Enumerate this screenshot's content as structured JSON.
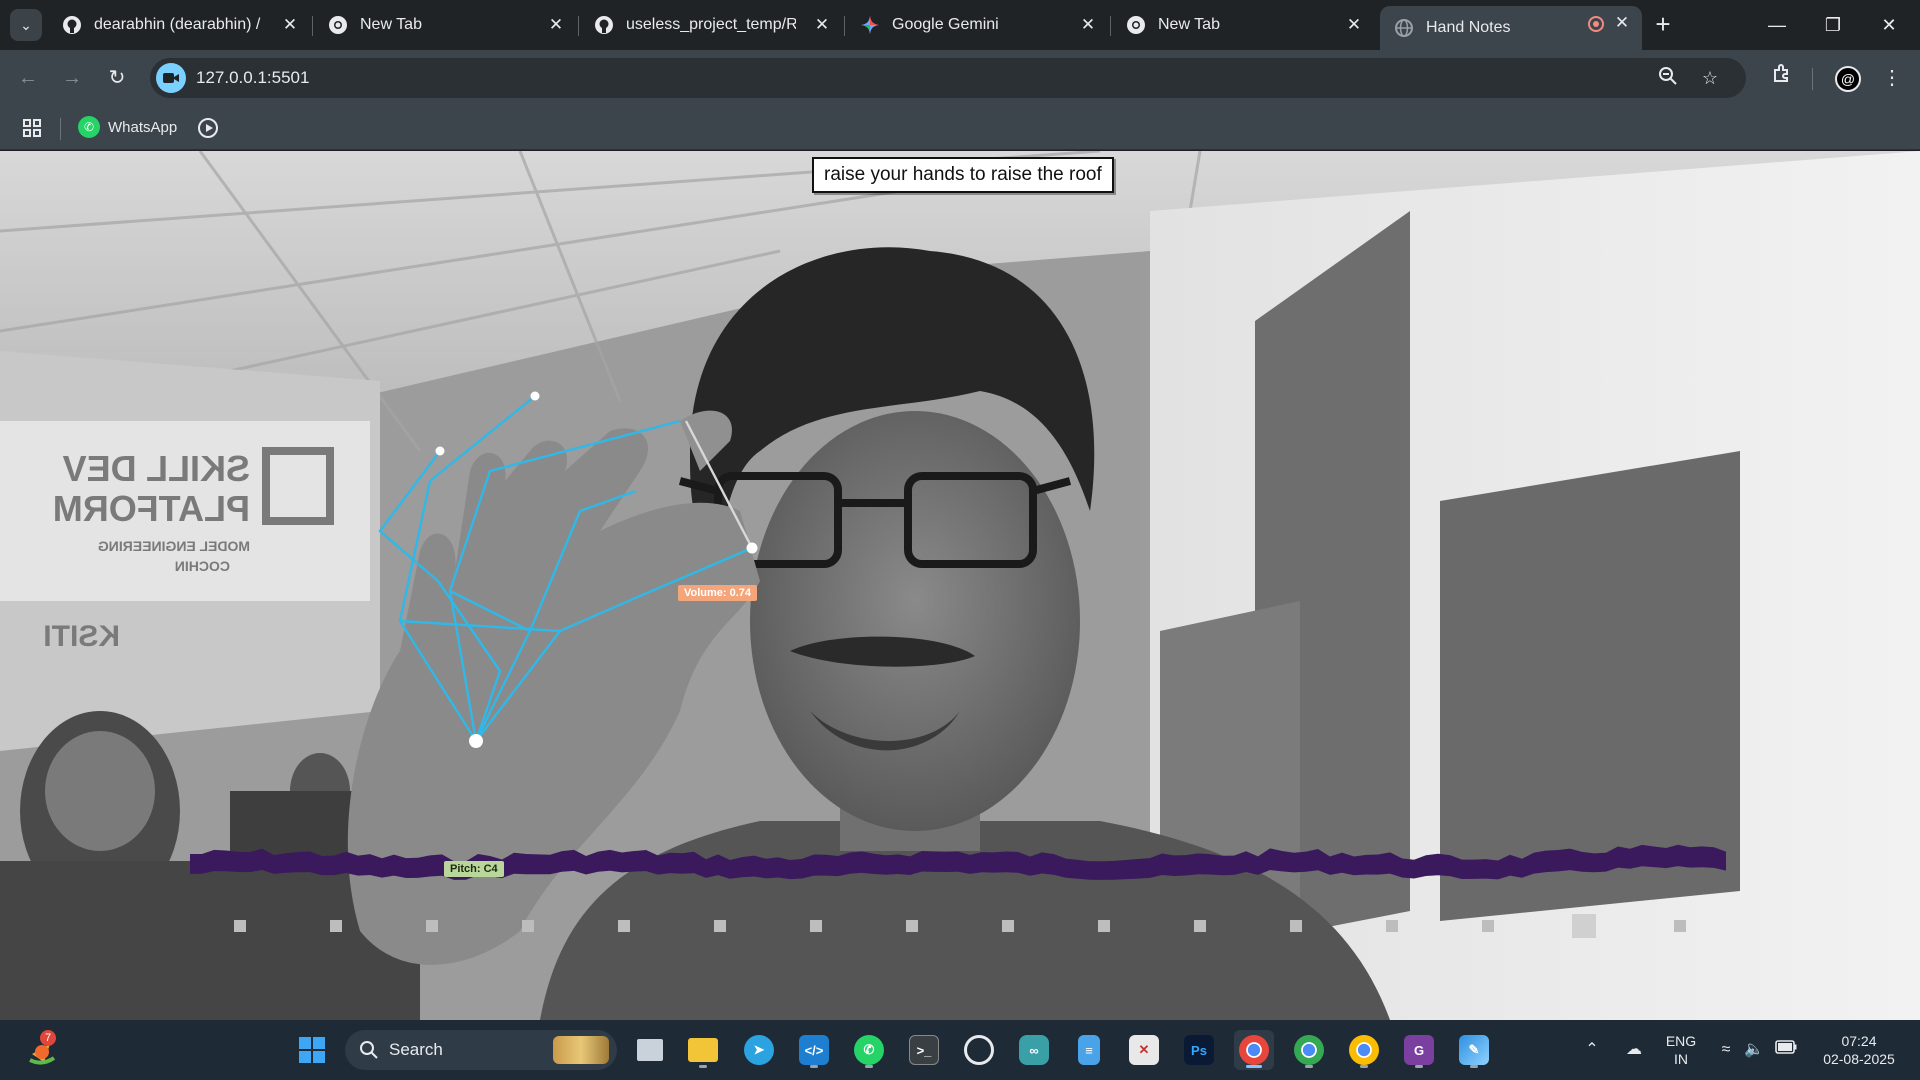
{
  "browser": {
    "tabs": [
      {
        "title": "dearabhin (dearabhin) / Re",
        "icon": "github-icon",
        "active": false
      },
      {
        "title": "New Tab",
        "icon": "chrome-icon",
        "active": false
      },
      {
        "title": "useless_project_temp/REAI",
        "icon": "github-icon",
        "active": false
      },
      {
        "title": "Google Gemini",
        "icon": "gemini-icon",
        "active": false
      },
      {
        "title": "New Tab",
        "icon": "chrome-icon",
        "active": false
      },
      {
        "title": "Hand Notes",
        "icon": "globe-icon",
        "active": true,
        "recording": true
      }
    ],
    "url": "127.0.0.1:5501",
    "bookmarks": [
      {
        "label": "WhatsApp",
        "icon": "whatsapp-icon"
      }
    ]
  },
  "app": {
    "prompt": "raise your hands to raise the roof",
    "volume_label": "Volume: 0.74",
    "pitch_label": "Pitch: C4",
    "keys_count": 16,
    "active_key_index": 14,
    "colors": {
      "hand_skeleton": "#2fb8e8",
      "waveform": "#3a1a5c",
      "volume_badge": "#f4a57a",
      "pitch_badge": "#b9d79a"
    }
  },
  "taskbar": {
    "search_placeholder": "Search",
    "notification_count": "7",
    "language": "ENG",
    "region": "IN",
    "time": "07:24",
    "date": "02-08-2025",
    "pinned_apps": [
      "start-icon",
      "task-view-icon",
      "file-explorer-icon",
      "telegram-icon",
      "vscode-icon",
      "whatsapp-icon",
      "terminal-icon",
      "chatgpt-icon",
      "infinity-app-icon",
      "notepad-icon",
      "pdf-app-icon",
      "photoshop-icon",
      "chrome-icon",
      "chrome-profile-icon",
      "chrome-profile-2-icon",
      "pdf-reader-icon",
      "paint-icon"
    ]
  }
}
